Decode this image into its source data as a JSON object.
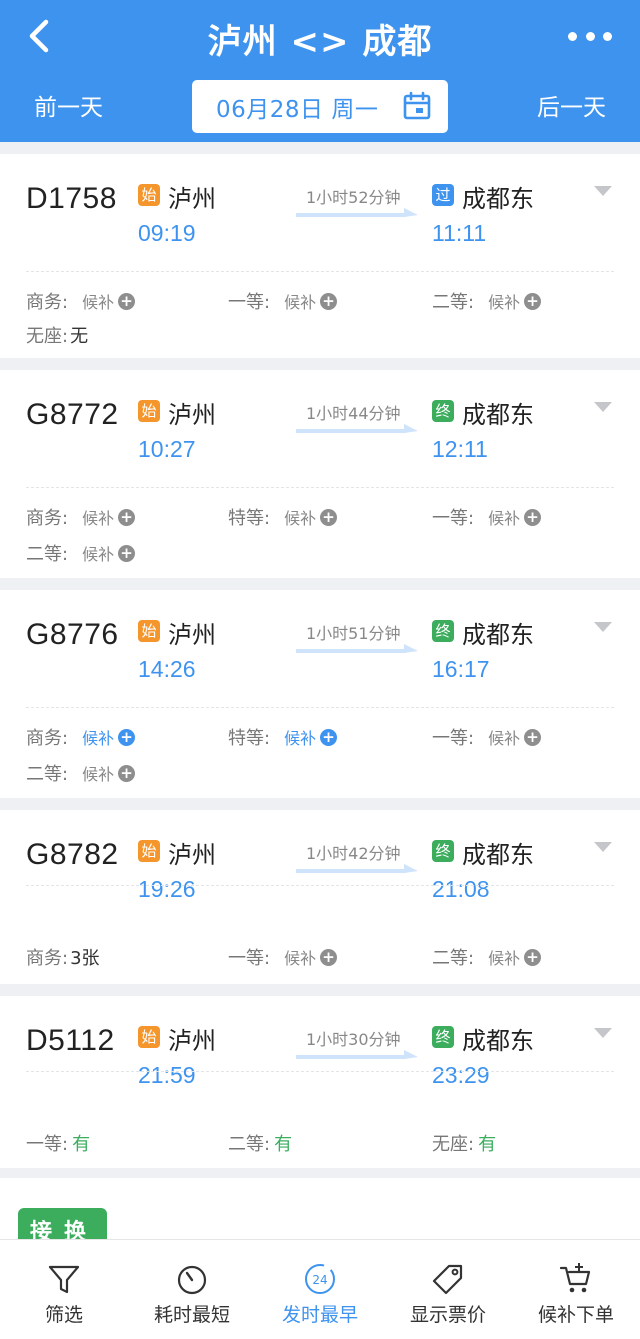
{
  "header": {
    "title": "泸州 <> 成都",
    "prev_day": "前一天",
    "next_day": "后一天",
    "date": "06月28日 周一"
  },
  "trains": [
    {
      "no": "D1758",
      "dep_tag": "始",
      "dep_station": "泸州",
      "dep_time": "09:19",
      "duration": "1小时52分钟",
      "arr_tag": "过",
      "arr_station": "成都东",
      "arr_time": "11:11",
      "seats": [
        {
          "label": "商务:",
          "value": "候补"
        },
        {
          "label": "一等:",
          "value": "候补"
        },
        {
          "label": "二等:",
          "value": "候补"
        },
        {
          "label": "无座:",
          "value": "无"
        }
      ]
    },
    {
      "no": "G8772",
      "dep_tag": "始",
      "dep_station": "泸州",
      "dep_time": "10:27",
      "duration": "1小时44分钟",
      "arr_tag": "终",
      "arr_station": "成都东",
      "arr_time": "12:11",
      "seats": [
        {
          "label": "商务:",
          "value": "候补"
        },
        {
          "label": "特等:",
          "value": "候补"
        },
        {
          "label": "一等:",
          "value": "候补"
        },
        {
          "label": "二等:",
          "value": "候补"
        }
      ]
    },
    {
      "no": "G8776",
      "dep_tag": "始",
      "dep_station": "泸州",
      "dep_time": "14:26",
      "duration": "1小时51分钟",
      "arr_tag": "终",
      "arr_station": "成都东",
      "arr_time": "16:17",
      "seats": [
        {
          "label": "商务:",
          "value": "候补"
        },
        {
          "label": "特等:",
          "value": "候补"
        },
        {
          "label": "一等:",
          "value": "候补"
        },
        {
          "label": "二等:",
          "value": "候补"
        }
      ]
    },
    {
      "no": "G8782",
      "dep_tag": "始",
      "dep_station": "泸州",
      "dep_time": "19:26",
      "duration": "1小时42分钟",
      "arr_tag": "终",
      "arr_station": "成都东",
      "arr_time": "21:08",
      "seats": [
        {
          "label": "商务:",
          "value": "3张"
        },
        {
          "label": "一等:",
          "value": "候补"
        },
        {
          "label": "二等:",
          "value": "候补"
        }
      ]
    },
    {
      "no": "D5112",
      "dep_tag": "始",
      "dep_station": "泸州",
      "dep_time": "21:59",
      "duration": "1小时30分钟",
      "arr_tag": "终",
      "arr_station": "成都东",
      "arr_time": "23:29",
      "seats": [
        {
          "label": "一等:",
          "value": "有"
        },
        {
          "label": "二等:",
          "value": "有"
        },
        {
          "label": "无座:",
          "value": "有"
        }
      ]
    }
  ],
  "transfer_tag": "接换",
  "bottom_tabs": [
    {
      "label": "筛选",
      "icon": "filter-icon"
    },
    {
      "label": "耗时最短",
      "icon": "timer-icon"
    },
    {
      "label": "发时最早",
      "icon": "clock-24-icon",
      "icon_text": "24"
    },
    {
      "label": "显示票价",
      "icon": "price-tag-icon"
    },
    {
      "label": "候补下单",
      "icon": "cart-plus-icon"
    }
  ],
  "colors": {
    "brand_blue": "#3e93ef",
    "orange_tag": "#f5962d",
    "green": "#3bad5d"
  }
}
